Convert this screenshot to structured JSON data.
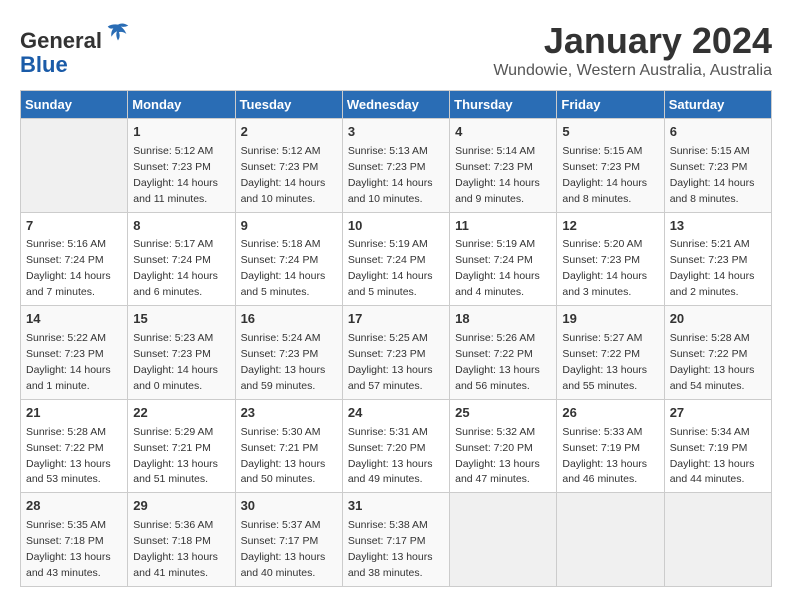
{
  "header": {
    "logo_line1": "General",
    "logo_line2": "Blue",
    "month": "January 2024",
    "location": "Wundowie, Western Australia, Australia"
  },
  "weekdays": [
    "Sunday",
    "Monday",
    "Tuesday",
    "Wednesday",
    "Thursday",
    "Friday",
    "Saturday"
  ],
  "weeks": [
    [
      {
        "day": "",
        "empty": true
      },
      {
        "day": "1",
        "sunrise": "5:12 AM",
        "sunset": "7:23 PM",
        "daylight": "14 hours and 11 minutes."
      },
      {
        "day": "2",
        "sunrise": "5:12 AM",
        "sunset": "7:23 PM",
        "daylight": "14 hours and 10 minutes."
      },
      {
        "day": "3",
        "sunrise": "5:13 AM",
        "sunset": "7:23 PM",
        "daylight": "14 hours and 10 minutes."
      },
      {
        "day": "4",
        "sunrise": "5:14 AM",
        "sunset": "7:23 PM",
        "daylight": "14 hours and 9 minutes."
      },
      {
        "day": "5",
        "sunrise": "5:15 AM",
        "sunset": "7:23 PM",
        "daylight": "14 hours and 8 minutes."
      },
      {
        "day": "6",
        "sunrise": "5:15 AM",
        "sunset": "7:23 PM",
        "daylight": "14 hours and 8 minutes."
      }
    ],
    [
      {
        "day": "7",
        "sunrise": "5:16 AM",
        "sunset": "7:24 PM",
        "daylight": "14 hours and 7 minutes."
      },
      {
        "day": "8",
        "sunrise": "5:17 AM",
        "sunset": "7:24 PM",
        "daylight": "14 hours and 6 minutes."
      },
      {
        "day": "9",
        "sunrise": "5:18 AM",
        "sunset": "7:24 PM",
        "daylight": "14 hours and 5 minutes."
      },
      {
        "day": "10",
        "sunrise": "5:19 AM",
        "sunset": "7:24 PM",
        "daylight": "14 hours and 5 minutes."
      },
      {
        "day": "11",
        "sunrise": "5:19 AM",
        "sunset": "7:24 PM",
        "daylight": "14 hours and 4 minutes."
      },
      {
        "day": "12",
        "sunrise": "5:20 AM",
        "sunset": "7:23 PM",
        "daylight": "14 hours and 3 minutes."
      },
      {
        "day": "13",
        "sunrise": "5:21 AM",
        "sunset": "7:23 PM",
        "daylight": "14 hours and 2 minutes."
      }
    ],
    [
      {
        "day": "14",
        "sunrise": "5:22 AM",
        "sunset": "7:23 PM",
        "daylight": "14 hours and 1 minute."
      },
      {
        "day": "15",
        "sunrise": "5:23 AM",
        "sunset": "7:23 PM",
        "daylight": "14 hours and 0 minutes."
      },
      {
        "day": "16",
        "sunrise": "5:24 AM",
        "sunset": "7:23 PM",
        "daylight": "13 hours and 59 minutes."
      },
      {
        "day": "17",
        "sunrise": "5:25 AM",
        "sunset": "7:23 PM",
        "daylight": "13 hours and 57 minutes."
      },
      {
        "day": "18",
        "sunrise": "5:26 AM",
        "sunset": "7:22 PM",
        "daylight": "13 hours and 56 minutes."
      },
      {
        "day": "19",
        "sunrise": "5:27 AM",
        "sunset": "7:22 PM",
        "daylight": "13 hours and 55 minutes."
      },
      {
        "day": "20",
        "sunrise": "5:28 AM",
        "sunset": "7:22 PM",
        "daylight": "13 hours and 54 minutes."
      }
    ],
    [
      {
        "day": "21",
        "sunrise": "5:28 AM",
        "sunset": "7:22 PM",
        "daylight": "13 hours and 53 minutes."
      },
      {
        "day": "22",
        "sunrise": "5:29 AM",
        "sunset": "7:21 PM",
        "daylight": "13 hours and 51 minutes."
      },
      {
        "day": "23",
        "sunrise": "5:30 AM",
        "sunset": "7:21 PM",
        "daylight": "13 hours and 50 minutes."
      },
      {
        "day": "24",
        "sunrise": "5:31 AM",
        "sunset": "7:20 PM",
        "daylight": "13 hours and 49 minutes."
      },
      {
        "day": "25",
        "sunrise": "5:32 AM",
        "sunset": "7:20 PM",
        "daylight": "13 hours and 47 minutes."
      },
      {
        "day": "26",
        "sunrise": "5:33 AM",
        "sunset": "7:19 PM",
        "daylight": "13 hours and 46 minutes."
      },
      {
        "day": "27",
        "sunrise": "5:34 AM",
        "sunset": "7:19 PM",
        "daylight": "13 hours and 44 minutes."
      }
    ],
    [
      {
        "day": "28",
        "sunrise": "5:35 AM",
        "sunset": "7:18 PM",
        "daylight": "13 hours and 43 minutes."
      },
      {
        "day": "29",
        "sunrise": "5:36 AM",
        "sunset": "7:18 PM",
        "daylight": "13 hours and 41 minutes."
      },
      {
        "day": "30",
        "sunrise": "5:37 AM",
        "sunset": "7:17 PM",
        "daylight": "13 hours and 40 minutes."
      },
      {
        "day": "31",
        "sunrise": "5:38 AM",
        "sunset": "7:17 PM",
        "daylight": "13 hours and 38 minutes."
      },
      {
        "day": "",
        "empty": true
      },
      {
        "day": "",
        "empty": true
      },
      {
        "day": "",
        "empty": true
      }
    ]
  ]
}
